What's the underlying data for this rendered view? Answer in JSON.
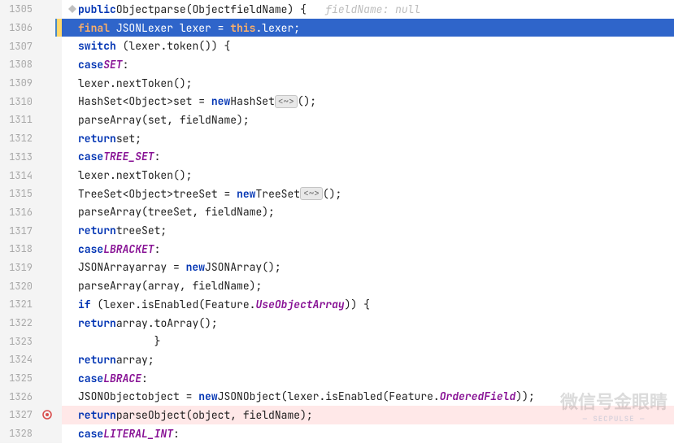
{
  "gutter": {
    "1305": "1305",
    "1306": "1306",
    "1307": "1307",
    "1308": "1308",
    "1309": "1309",
    "1310": "1310",
    "1311": "1311",
    "1312": "1312",
    "1313": "1313",
    "1314": "1314",
    "1315": "1315",
    "1316": "1316",
    "1317": "1317",
    "1318": "1318",
    "1319": "1319",
    "1320": "1320",
    "1321": "1321",
    "1322": "1322",
    "1323": "1323",
    "1324": "1324",
    "1325": "1325",
    "1326": "1326",
    "1327": "1327",
    "1328": "1328"
  },
  "kw": {
    "public": "public",
    "final": "final",
    "switch": "switch",
    "case": "case",
    "new": "new",
    "return": "return",
    "if": "if",
    "this": "this"
  },
  "tokens": {
    "Object": "Object",
    "parse": "parse",
    "fieldName": "fieldName",
    "JSONLexer": "JSONLexer",
    "lexer": "lexer",
    "token": "token",
    "SET": "SET",
    "nextToken": "nextToken",
    "HashSet": "HashSet",
    "ObjectT": "Object",
    "set": "set",
    "parseArray": "parseArray",
    "TREE_SET": "TREE_SET",
    "TreeSet": "TreeSet",
    "treeSet": "treeSet",
    "LBRACKET": "LBRACKET",
    "JSONArray": "JSONArray",
    "array": "array",
    "isEnabled": "isEnabled",
    "Feature": "Feature",
    "UseObjectArray": "UseObjectArray",
    "toArray": "toArray",
    "LBRACE": "LBRACE",
    "JSONObject": "JSONObject",
    "object": "object",
    "OrderedField": "OrderedField",
    "parseObject": "parseObject",
    "LITERAL_INT": "LITERAL_INT"
  },
  "hints": {
    "fieldNameNull": "fieldName: null"
  },
  "symbols": {
    "diamond": "~",
    "lt": "<",
    "gt": ">"
  },
  "watermark": {
    "main": "微信号金眼睛",
    "sub": "— SECPULSE —"
  }
}
